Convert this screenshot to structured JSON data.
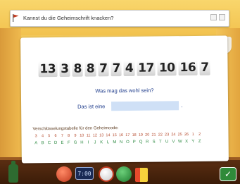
{
  "window": {
    "title": "Kannst du die Geheimschrift knacken?"
  },
  "puzzle": {
    "code_numbers": [
      "13",
      "3",
      "8",
      "8",
      "7",
      "7",
      "4",
      "17",
      "10",
      "16",
      "7"
    ],
    "question": "Was mag das wohl sein?",
    "answer_prefix": "Das ist eine",
    "answer_value": "",
    "answer_suffix": "."
  },
  "cipher_table": {
    "title": "Verschlüsselungstabelle für den Geheimcode:",
    "numbers": [
      "3",
      "4",
      "5",
      "6",
      "7",
      "8",
      "9",
      "10",
      "11",
      "12",
      "13",
      "14",
      "15",
      "16",
      "17",
      "18",
      "19",
      "20",
      "21",
      "22",
      "23",
      "24",
      "25",
      "26",
      "1",
      "2"
    ],
    "letters": [
      "A",
      "B",
      "C",
      "D",
      "E",
      "F",
      "G",
      "H",
      "I",
      "J",
      "K",
      "L",
      "M",
      "N",
      "O",
      "P",
      "Q",
      "R",
      "S",
      "T",
      "U",
      "V",
      "W",
      "X",
      "Y",
      "Z"
    ]
  },
  "toolbar": {
    "clock_text": "7:00"
  },
  "colors": {
    "number_row": "#b4482b",
    "letter_row": "#2d8a42",
    "text_blue": "#1c3a8a",
    "input_bg": "#cfe0f6"
  }
}
